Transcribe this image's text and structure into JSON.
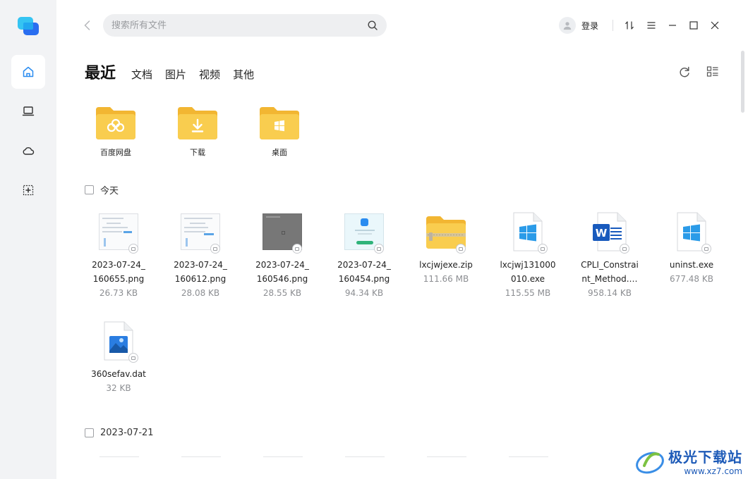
{
  "app": {
    "search_placeholder": "搜索所有文件",
    "login_label": "登录"
  },
  "nav": {
    "items": [
      {
        "name": "home",
        "icon": "home-icon",
        "active": true
      },
      {
        "name": "computer",
        "icon": "laptop-icon",
        "active": false
      },
      {
        "name": "cloud",
        "icon": "cloud-icon",
        "active": false
      },
      {
        "name": "add",
        "icon": "add-box-icon",
        "active": false
      }
    ]
  },
  "tabs": [
    {
      "label": "最近",
      "active": true
    },
    {
      "label": "文档",
      "active": false
    },
    {
      "label": "图片",
      "active": false
    },
    {
      "label": "视频",
      "active": false
    },
    {
      "label": "其他",
      "active": false
    }
  ],
  "quick_folders": [
    {
      "label": "百度网盘",
      "icon": "baidu-netdisk-folder-icon"
    },
    {
      "label": "下载",
      "icon": "download-folder-icon"
    },
    {
      "label": "桌面",
      "icon": "desktop-folder-icon"
    }
  ],
  "sections": [
    {
      "label": "今天",
      "files": [
        {
          "name": "2023-07-24_160655.png",
          "name_display": "2023-07-24_\n160655.png",
          "size": "26.73 KB",
          "kind": "screenshot-light"
        },
        {
          "name": "2023-07-24_160612.png",
          "name_display": "2023-07-24_\n160612.png",
          "size": "28.08 KB",
          "kind": "screenshot-light"
        },
        {
          "name": "2023-07-24_160546.png",
          "name_display": "2023-07-24_\n160546.png",
          "size": "28.55 KB",
          "kind": "screenshot-dark"
        },
        {
          "name": "2023-07-24_160454.png",
          "name_display": "2023-07-24_\n160454.png",
          "size": "94.34 KB",
          "kind": "screenshot-app"
        },
        {
          "name": "lxcjwjexe.zip",
          "name_display": "lxcjwjexe.zip",
          "size": "111.66 MB",
          "kind": "zip"
        },
        {
          "name": "lxcjwj131000010.exe",
          "name_display": "lxcjwj131000\n010.exe",
          "size": "115.55 MB",
          "kind": "exe"
        },
        {
          "name": "CPLI_Constraint_Method.…",
          "name_display": "CPLI_Constrai\nnt_Method.…",
          "size": "958.14 KB",
          "kind": "word"
        },
        {
          "name": "uninst.exe",
          "name_display": "uninst.exe",
          "size": "677.48 KB",
          "kind": "exe"
        },
        {
          "name": "360sefav.dat",
          "name_display": "360sefav.dat",
          "size": "32 KB",
          "kind": "image-file"
        }
      ]
    },
    {
      "label": "2023-07-21",
      "files": []
    }
  ],
  "watermark": {
    "brand": "极光下载站",
    "url": "www.xz7.com"
  },
  "colors": {
    "rail_bg": "#f2f3f5",
    "folder_yellow": "#f7c948",
    "accent_blue": "#2a8cf0",
    "word_blue": "#185abd"
  }
}
